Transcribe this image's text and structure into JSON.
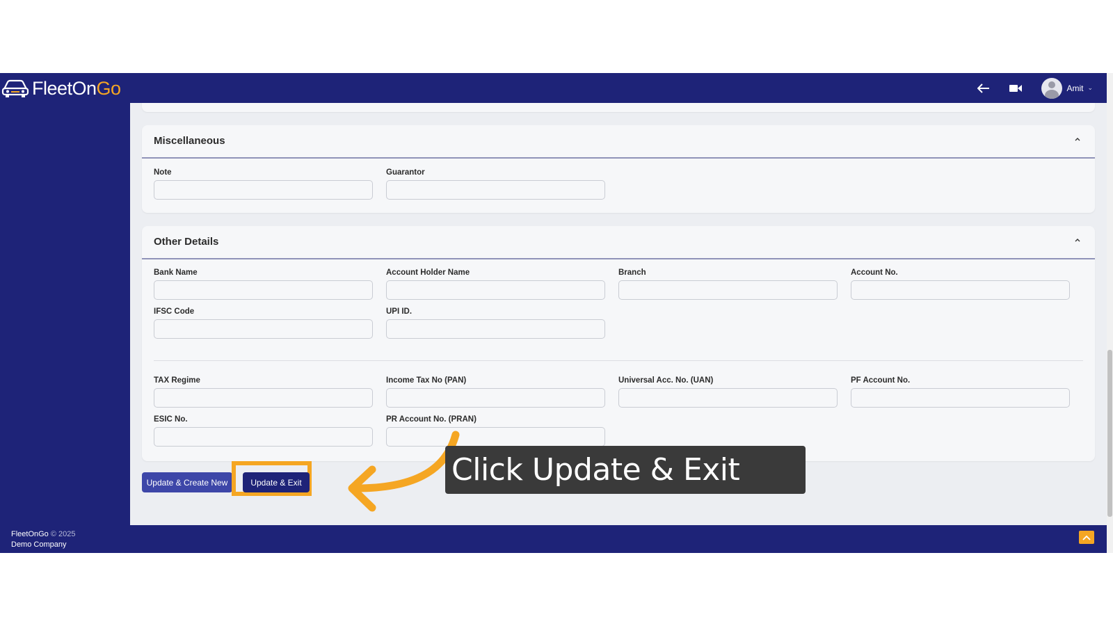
{
  "app": {
    "logo_fleet": "FleetOn",
    "logo_go": "Go",
    "user_name": "Amit"
  },
  "icons": {
    "back": "back-arrow-icon",
    "video": "video-camera-icon",
    "avatar": "user-avatar-icon",
    "chevron": "chevron-down-icon",
    "collapse": "chevron-up-icon",
    "scroll_top": "scroll-to-top-icon"
  },
  "sections": {
    "miscellaneous": {
      "title": "Miscellaneous",
      "fields": {
        "note": {
          "label": "Note",
          "value": ""
        },
        "guarantor": {
          "label": "Guarantor",
          "value": ""
        }
      }
    },
    "other_details": {
      "title": "Other Details",
      "fields": {
        "bank_name": {
          "label": "Bank Name",
          "value": ""
        },
        "account_holder_name": {
          "label": "Account Holder Name",
          "value": ""
        },
        "branch": {
          "label": "Branch",
          "value": ""
        },
        "account_no": {
          "label": "Account No.",
          "value": ""
        },
        "ifsc_code": {
          "label": "IFSC Code",
          "value": ""
        },
        "upi_id": {
          "label": "UPI ID.",
          "value": ""
        },
        "tax_regime": {
          "label": "TAX Regime",
          "value": ""
        },
        "income_tax_no": {
          "label": "Income Tax No (PAN)",
          "value": ""
        },
        "uan": {
          "label": "Universal Acc. No. (UAN)",
          "value": ""
        },
        "pf_account_no": {
          "label": "PF Account No.",
          "value": ""
        },
        "esic_no": {
          "label": "ESIC No.",
          "value": ""
        },
        "pran": {
          "label": "PR Account No. (PRAN)",
          "value": ""
        }
      }
    }
  },
  "actions": {
    "update_create_new": "Update & Create New",
    "update_exit": "Update & Exit"
  },
  "footer": {
    "brand": "FleetOnGo",
    "copyright": "© 2025",
    "company": "Demo Company"
  },
  "annotation": {
    "callout_text": "Click Update & Exit",
    "highlight_color": "#f5a623"
  },
  "colors": {
    "brand_navy": "#1e2378",
    "accent_orange": "#f5a623",
    "content_bg": "#eceef2"
  }
}
